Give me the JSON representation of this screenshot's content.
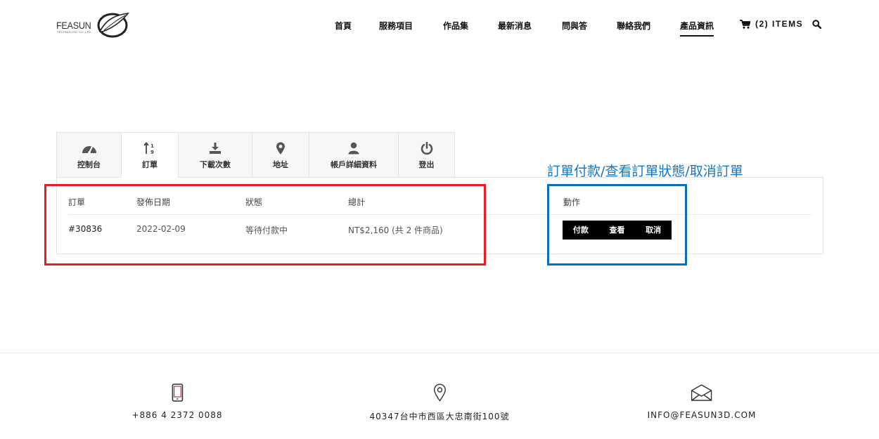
{
  "logo": {
    "text": "FEASUN",
    "subtext": "TECHNOLOGY CO.,LTD."
  },
  "nav": {
    "items": [
      {
        "label": "首頁"
      },
      {
        "label": "服務項目"
      },
      {
        "label": "作品集"
      },
      {
        "label": "最新消息"
      },
      {
        "label": "問與答"
      },
      {
        "label": "聯絡我們"
      },
      {
        "label": "產品資訊",
        "active": true
      }
    ],
    "cart_icon": "cart-icon",
    "cart_label": "(2) ITEMS",
    "search_icon": "search-icon"
  },
  "tabs": [
    {
      "label": "控制台",
      "icon": "dashboard-icon"
    },
    {
      "label": "訂單",
      "icon": "sort-order-icon",
      "active": true
    },
    {
      "label": "下載次數",
      "icon": "download-icon"
    },
    {
      "label": "地址",
      "icon": "map-pin-icon"
    },
    {
      "label": "帳戶詳細資料",
      "icon": "user-icon"
    },
    {
      "label": "登出",
      "icon": "power-icon"
    }
  ],
  "orders": {
    "headers": {
      "order": "訂單",
      "date": "發佈日期",
      "status": "狀態",
      "total": "總計",
      "actions": "動作"
    },
    "rows": [
      {
        "order": "#30836",
        "date": "2022-02-09",
        "status": "等待付款中",
        "total": "NT$2,160 (共 2 件商品)"
      }
    ],
    "actions": {
      "pay": "付款",
      "view": "查看",
      "cancel": "取消"
    }
  },
  "annotation": {
    "note": "訂單付款/查看訂單狀態/取消訂單",
    "red_color": "#e31e24",
    "blue_color": "#0b6fb5"
  },
  "footer": {
    "phone": "+886 4 2372 0088",
    "address": "40347台中市西區大忠南街100號",
    "email": "INFO@FEASUN3D.COM",
    "icons": [
      "phone-icon",
      "location-icon",
      "mail-icon"
    ]
  }
}
